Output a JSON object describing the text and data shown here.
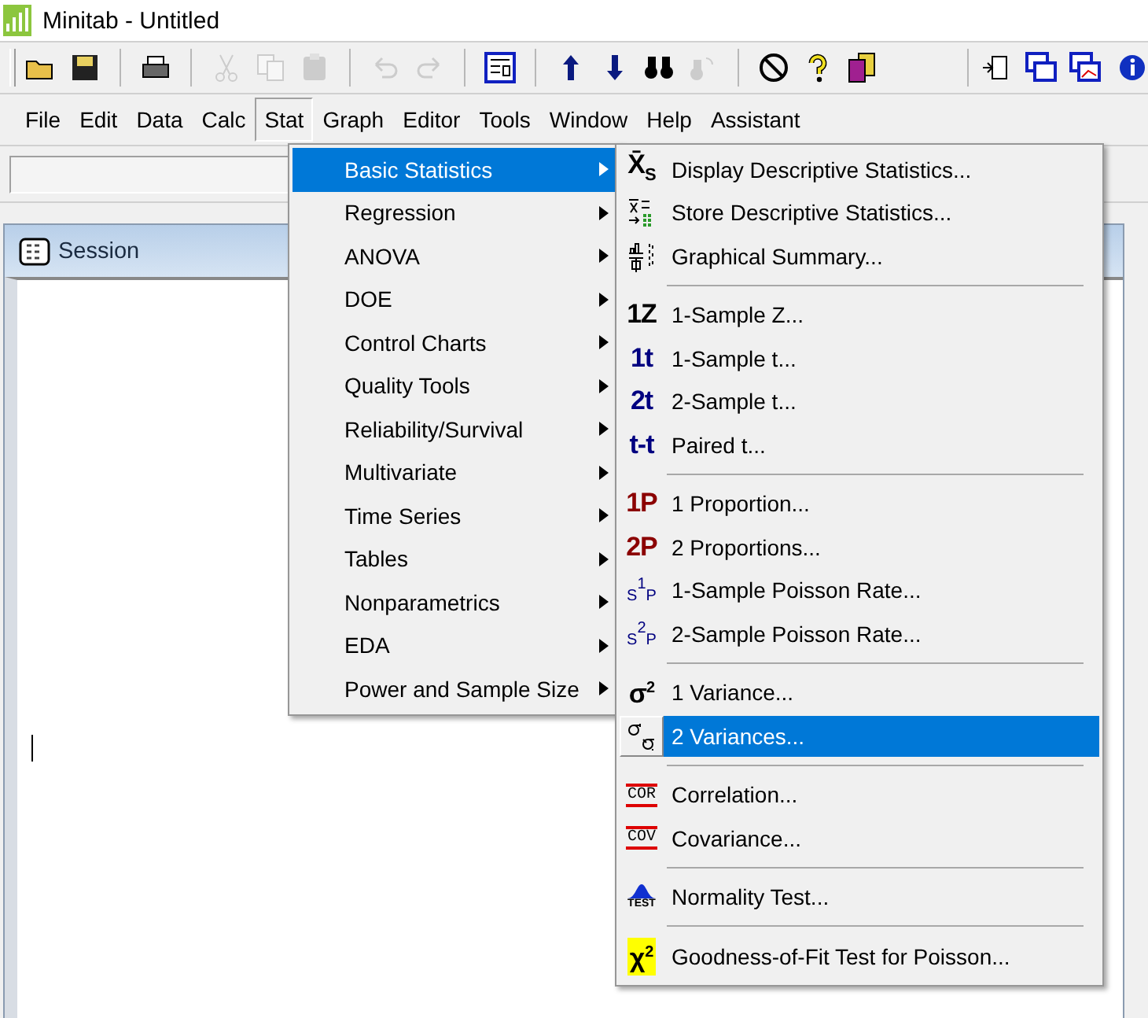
{
  "window": {
    "title": "Minitab - Untitled"
  },
  "toolbar": [
    {
      "kind": "open",
      "disabled": false
    },
    {
      "kind": "save",
      "disabled": false
    },
    {
      "kind": "sep"
    },
    {
      "kind": "print",
      "disabled": false
    },
    {
      "kind": "sep"
    },
    {
      "kind": "cut",
      "disabled": true
    },
    {
      "kind": "copy",
      "disabled": true
    },
    {
      "kind": "paste",
      "disabled": true
    },
    {
      "kind": "sep"
    },
    {
      "kind": "undo",
      "disabled": true
    },
    {
      "kind": "redo",
      "disabled": true
    },
    {
      "kind": "sep"
    },
    {
      "kind": "session",
      "disabled": false
    },
    {
      "kind": "sep"
    },
    {
      "kind": "up",
      "disabled": false
    },
    {
      "kind": "down",
      "disabled": false
    },
    {
      "kind": "find",
      "disabled": false
    },
    {
      "kind": "replace",
      "disabled": true
    },
    {
      "kind": "sep"
    },
    {
      "kind": "cancel",
      "disabled": false
    },
    {
      "kind": "help",
      "disabled": false
    },
    {
      "kind": "stack",
      "disabled": false
    }
  ],
  "toolbar_right": [
    {
      "kind": "script",
      "disabled": false
    },
    {
      "kind": "windows",
      "disabled": false
    },
    {
      "kind": "graphs",
      "disabled": false
    },
    {
      "kind": "info",
      "disabled": false
    }
  ],
  "menu_bar": [
    {
      "label": "File",
      "selected": false
    },
    {
      "label": "Edit",
      "selected": false
    },
    {
      "label": "Data",
      "selected": false
    },
    {
      "label": "Calc",
      "selected": false
    },
    {
      "label": "Stat",
      "selected": true
    },
    {
      "label": "Graph",
      "selected": false
    },
    {
      "label": "Editor",
      "selected": false
    },
    {
      "label": "Tools",
      "selected": false
    },
    {
      "label": "Window",
      "selected": false
    },
    {
      "label": "Help",
      "selected": false
    },
    {
      "label": "Assistant",
      "selected": false
    }
  ],
  "stat_menu": [
    {
      "label": "Basic Statistics",
      "selected": true
    },
    {
      "label": "Regression",
      "selected": false
    },
    {
      "label": "ANOVA",
      "selected": false
    },
    {
      "label": "DOE",
      "selected": false
    },
    {
      "label": "Control Charts",
      "selected": false
    },
    {
      "label": "Quality Tools",
      "selected": false
    },
    {
      "label": "Reliability/Survival",
      "selected": false
    },
    {
      "label": "Multivariate",
      "selected": false
    },
    {
      "label": "Time Series",
      "selected": false
    },
    {
      "label": "Tables",
      "selected": false
    },
    {
      "label": "Nonparametrics",
      "selected": false
    },
    {
      "label": "EDA",
      "selected": false
    },
    {
      "label": "Power and Sample Size",
      "selected": false
    }
  ],
  "basic_statistics_menu": [
    {
      "kind": "item",
      "label": "Display Descriptive Statistics...",
      "selected": false,
      "icon": {
        "kind": "glyph",
        "text": "X̄$_{S}$",
        "color": "#000000"
      }
    },
    {
      "kind": "item",
      "label": "Store Descriptive Statistics...",
      "selected": false,
      "icon": {
        "kind": "store"
      }
    },
    {
      "kind": "item",
      "label": "Graphical Summary...",
      "selected": false,
      "icon": {
        "kind": "summary"
      }
    },
    {
      "kind": "separator"
    },
    {
      "kind": "item",
      "label": "1-Sample Z...",
      "selected": false,
      "icon": {
        "kind": "glyph",
        "text": "1Z",
        "color": "#000000"
      }
    },
    {
      "kind": "item",
      "label": "1-Sample t...",
      "selected": false,
      "icon": {
        "kind": "glyph",
        "text": "1t",
        "color": "#000080"
      }
    },
    {
      "kind": "item",
      "label": "2-Sample t...",
      "selected": false,
      "icon": {
        "kind": "glyph",
        "text": "2t",
        "color": "#000080"
      }
    },
    {
      "kind": "item",
      "label": "Paired t...",
      "selected": false,
      "icon": {
        "kind": "glyph",
        "text": "t-t",
        "color": "#000080"
      }
    },
    {
      "kind": "separator"
    },
    {
      "kind": "item",
      "label": "1 Proportion...",
      "selected": false,
      "icon": {
        "kind": "glyph",
        "text": "1P",
        "color": "#8b0000"
      }
    },
    {
      "kind": "item",
      "label": "2 Proportions...",
      "selected": false,
      "icon": {
        "kind": "glyph",
        "text": "2P",
        "color": "#8b0000"
      }
    },
    {
      "kind": "item",
      "label": "1-Sample Poisson Rate...",
      "selected": false,
      "icon": {
        "kind": "small",
        "text": "$_{S}$$^{1}$$_{P}$",
        "color": "#000080"
      }
    },
    {
      "kind": "item",
      "label": "2-Sample Poisson Rate...",
      "selected": false,
      "icon": {
        "kind": "small",
        "text": "$_{S}$$^{2}$$_{P}$",
        "color": "#000080"
      }
    },
    {
      "kind": "separator"
    },
    {
      "kind": "item",
      "label": "1 Variance...",
      "selected": false,
      "icon": {
        "kind": "glyph",
        "text": "σ$^{2}$",
        "color": "#000000"
      }
    },
    {
      "kind": "item",
      "label": "2 Variances...",
      "selected": true,
      "icon": {
        "kind": "variances"
      }
    },
    {
      "kind": "separator"
    },
    {
      "kind": "item",
      "label": "Correlation...",
      "selected": false,
      "icon": {
        "kind": "boxed",
        "text": "COR",
        "color": "#dd0000"
      }
    },
    {
      "kind": "item",
      "label": "Covariance...",
      "selected": false,
      "icon": {
        "kind": "boxed",
        "text": "COV",
        "color": "#dd0000"
      }
    },
    {
      "kind": "separator"
    },
    {
      "kind": "item",
      "label": "Normality Test...",
      "selected": false,
      "icon": {
        "kind": "test",
        "text": "TEST"
      }
    },
    {
      "kind": "separator"
    },
    {
      "kind": "item",
      "label": "Goodness-of-Fit Test for Poisson...",
      "selected": false,
      "icon": {
        "kind": "chi",
        "text": "χ$^{2}$"
      }
    }
  ],
  "session": {
    "title": "Session"
  }
}
